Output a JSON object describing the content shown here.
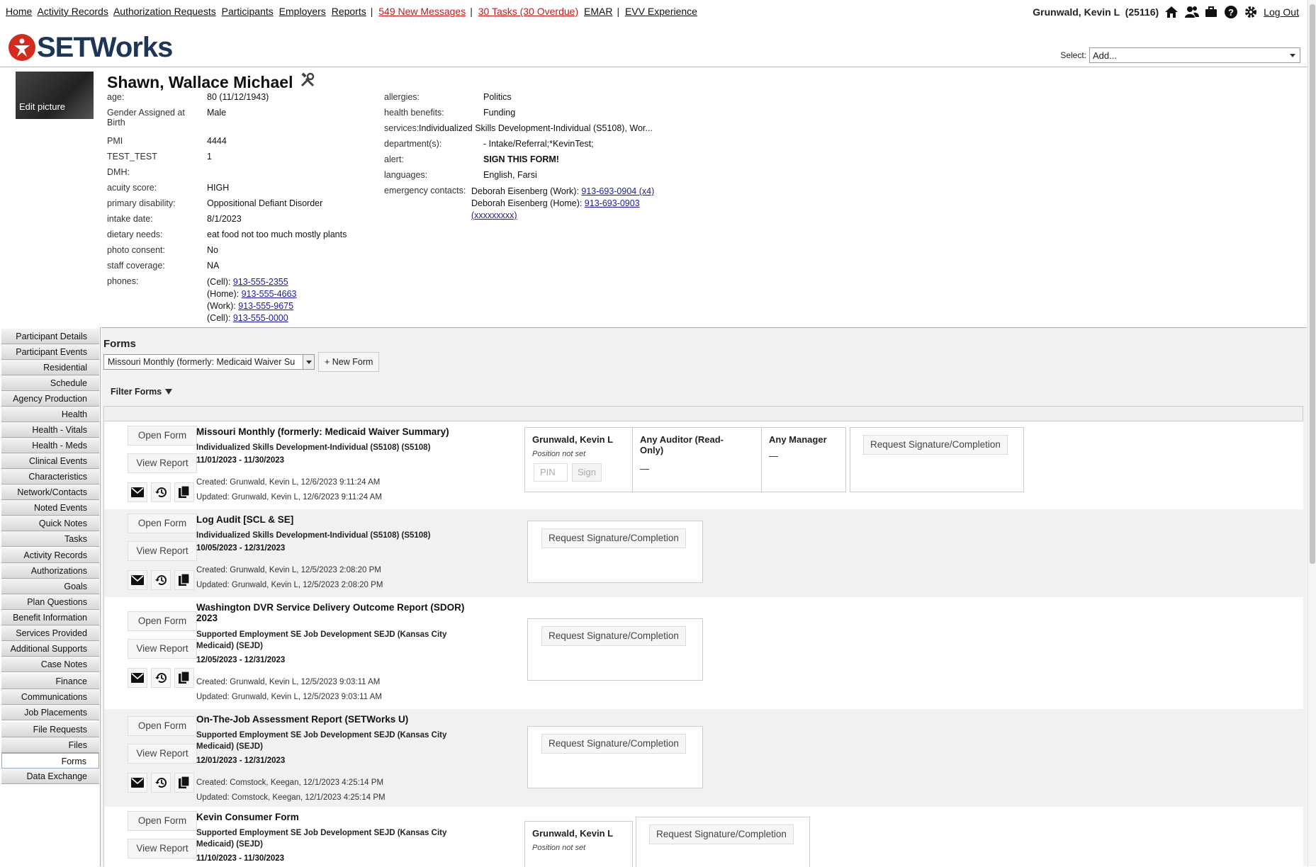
{
  "topnav": {
    "links": [
      "Home",
      "Activity Records",
      "Authorization Requests",
      "Participants",
      "Employers",
      "Reports"
    ],
    "messages": "549 New Messages",
    "tasks": "30 Tasks (30 Overdue)",
    "emar": "EMAR",
    "evv": "EVV Experience",
    "user": "Grunwald, Kevin L  (25116)",
    "logout": "Log Out"
  },
  "logo": {
    "text": "SETWorks"
  },
  "select": {
    "label": "Select:",
    "value": "Add..."
  },
  "participant": {
    "name": "Shawn, Wallace Michael",
    "edit_picture": "Edit picture",
    "left_fields": [
      {
        "k": "age:",
        "v": "80 (11/12/1943)"
      },
      {
        "k": "Gender Assigned at Birth",
        "v": "Male"
      },
      {
        "k": "PMI",
        "v": "4444"
      },
      {
        "k": "TEST_TEST",
        "v": "1"
      },
      {
        "k": "DMH:",
        "v": ""
      },
      {
        "k": "acuity score:",
        "v": "HIGH"
      },
      {
        "k": "primary disability:",
        "v": "Oppositional Defiant Disorder"
      },
      {
        "k": "intake date:",
        "v": "8/1/2023"
      },
      {
        "k": "dietary needs:",
        "v": "eat food not too much mostly plants"
      },
      {
        "k": "photo consent:",
        "v": "No"
      },
      {
        "k": "staff coverage:",
        "v": "NA"
      },
      {
        "k": "phones:",
        "v": ""
      }
    ],
    "phones": [
      {
        "type": "(Cell):",
        "num": "913-555-2355"
      },
      {
        "type": "(Home):",
        "num": "913-555-4663"
      },
      {
        "type": "(Work):",
        "num": "913-555-9675"
      },
      {
        "type": "(Cell):",
        "num": "913-555-0000"
      }
    ],
    "right_fields": {
      "allergies_k": "allergies:",
      "allergies_v": "Politics",
      "health_k": "health benefits:",
      "health_v": "Funding",
      "services_k": "services:",
      "services_v": "Individualized Skills Development-Individual (S5108), Wor...",
      "dept_k": "department(s):",
      "dept_v": "- Intake/Referral;*KevinTest;",
      "alert_k": "alert:",
      "alert_v": "SIGN THIS FORM!",
      "lang_k": "languages:",
      "lang_v": "English, Farsi",
      "emerg_k": "emergency contacts:",
      "emerg1_label": "Deborah Eisenberg (Work): ",
      "emerg1_num": "913-693-0904 (x4)",
      "emerg2_label": "Deborah Eisenberg (Home): ",
      "emerg2_num": "913-693-0903",
      "emerg2_ext": "(xxxxxxxxx)"
    }
  },
  "sidebar": [
    "Participant Details",
    "Participant Events",
    "Residential",
    "Schedule",
    "Agency Production",
    "Health",
    "Health - Vitals",
    "Health - Meds",
    "Clinical Events",
    "Characteristics",
    "Network/Contacts",
    "Noted Events",
    "Quick Notes",
    "Tasks",
    "Activity Records",
    "Authorizations",
    "Goals",
    "Plan Questions",
    "Benefit Information",
    "Services Provided",
    "Additional Supports",
    "Case Notes",
    "Finance",
    "Communications",
    "Job Placements",
    "File Requests",
    "Files",
    "Forms",
    "Data Exchange"
  ],
  "forms": {
    "title": "Forms",
    "select_value": "Missouri Monthly (formerly: Medicaid Waiver Su",
    "new_form": "+ New Form",
    "filter": "Filter Forms",
    "open": "Open Form",
    "view": "View Report",
    "request": "Request Signature/Completion",
    "items": [
      {
        "title": "Missouri Monthly (formerly: Medicaid Waiver Summary)",
        "service": "Individualized Skills Development-Individual (S5108) (S5108)",
        "dates": "11/01/2023 - 11/30/2023",
        "created": "Created: Grunwald, Kevin L, 12/6/2023 9:11:24 AM",
        "updated": "Updated: Grunwald, Kevin L, 12/6/2023 9:11:24 AM",
        "signer": "Grunwald, Kevin L",
        "position": "Position not set",
        "pin": "PIN",
        "sign": "Sign",
        "auditor": "Any Auditor (Read-Only)",
        "manager": "Any Manager",
        "dash": "—"
      },
      {
        "title": "Log Audit [SCL & SE]",
        "service": "Individualized Skills Development-Individual (S5108) (S5108)",
        "dates": "10/05/2023 - 12/31/2023",
        "created": "Created: Grunwald, Kevin L, 12/5/2023 2:08:20 PM",
        "updated": "Updated: Grunwald, Kevin L, 12/5/2023 2:08:20 PM"
      },
      {
        "title": "Washington DVR Service Delivery Outcome Report (SDOR) 2023",
        "service": "Supported Employment SE Job Development SEJD (Kansas City Medicaid) (SEJD)",
        "dates": "12/05/2023 - 12/31/2023",
        "created": "Created: Grunwald, Kevin L, 12/5/2023 9:03:11 AM",
        "updated": "Updated: Grunwald, Kevin L, 12/5/2023 9:03:11 AM"
      },
      {
        "title": "On-The-Job Assessment Report (SETWorks U)",
        "service": "Supported Employment SE Job Development SEJD (Kansas City Medicaid) (SEJD)",
        "dates": "12/01/2023 - 12/31/2023",
        "created": "Created: Comstock, Keegan, 12/1/2023 4:25:14 PM",
        "updated": "Updated: Comstock, Keegan, 12/1/2023 4:25:14 PM"
      },
      {
        "title": "Kevin Consumer Form",
        "service": "Supported Employment SE Job Development SEJD (Kansas City Medicaid) (SEJD)",
        "dates": "11/10/2023 - 11/30/2023",
        "signer": "Grunwald, Kevin L",
        "position": "Position not set"
      }
    ]
  },
  "colors": {
    "link": "#1a1aa6",
    "alert_red": "#d01b1b",
    "brand_navy": "#1d3557",
    "brand_red": "#d52b1e"
  }
}
